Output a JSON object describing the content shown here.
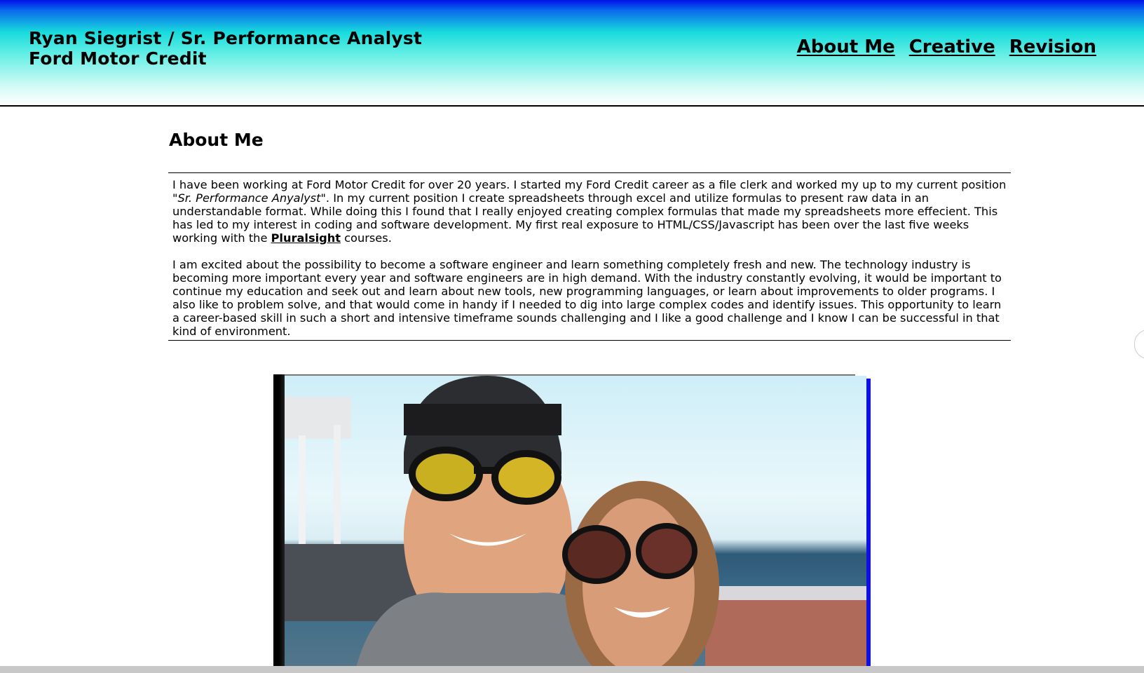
{
  "header": {
    "title_line1": "Ryan Siegrist / Sr. Performance Analyst",
    "title_line2": "Ford Motor Credit",
    "nav": [
      {
        "label": "About Me"
      },
      {
        "label": "Creative"
      },
      {
        "label": "Revision"
      }
    ]
  },
  "main": {
    "heading": "About Me",
    "para1": {
      "before_quote": "I have been working at Ford Motor Credit for over 20 years. I started my Ford Credit career as a file clerk and worked my up to my current position ",
      "quote": "\"Sr. Performance Anyalyst\"",
      "after_quote": ". In my current position I create spreadsheets through excel and utilize formulas to present raw data in an understandable format. While doing this I found that I really enjoyed creating complex formulas that made my spreadsheets more effecient. This has led to my interest in coding and software development. My first real exposure to HTML/CSS/Javascript has been over the last five weeks working with the ",
      "link": "Pluralsight",
      "end": " courses."
    },
    "para2": "I am excited about the possibility to become a software engineer and learn something completely fresh and new. The technology industry is becoming more important every year and software engineers are in high demand. With the industry constantly evolving, it would be important to continue my education and seek out and learn about new tools, new programming languages, or learn about improvements to older programs. I also like to problem solve, and that would come in handy if I needed to dig into large complex codes and identify issues. This opportunity to learn a career-based skill in such a short and intensive timeframe sounds challenging and I like a good challenge and I know I can be successful in that kind of environment."
  },
  "colors": {
    "header_gradient_top": "#0010e8",
    "header_gradient_mid": "#18dcdc",
    "photo_border": "#1010e0"
  }
}
